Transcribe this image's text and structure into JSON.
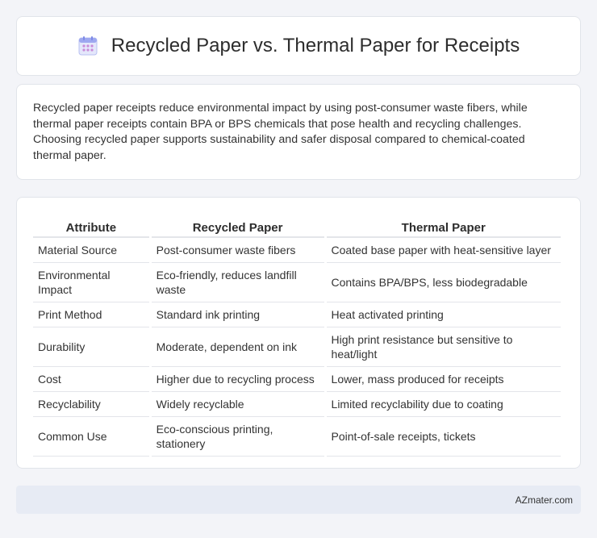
{
  "header": {
    "title": "Recycled Paper vs. Thermal Paper for Receipts",
    "icon": "calendar-icon"
  },
  "summary": {
    "text": "Recycled paper receipts reduce environmental impact by using post-consumer waste fibers, while thermal paper receipts contain BPA or BPS chemicals that pose health and recycling challenges. Choosing recycled paper supports sustainability and safer disposal compared to chemical-coated thermal paper."
  },
  "table": {
    "headers": [
      "Attribute",
      "Recycled Paper",
      "Thermal Paper"
    ],
    "rows": [
      [
        "Material Source",
        "Post-consumer waste fibers",
        "Coated base paper with heat-sensitive layer"
      ],
      [
        "Environmental Impact",
        "Eco-friendly, reduces landfill waste",
        "Contains BPA/BPS, less biodegradable"
      ],
      [
        "Print Method",
        "Standard ink printing",
        "Heat activated printing"
      ],
      [
        "Durability",
        "Moderate, dependent on ink",
        "High print resistance but sensitive to heat/light"
      ],
      [
        "Cost",
        "Higher due to recycling process",
        "Lower, mass produced for receipts"
      ],
      [
        "Recyclability",
        "Widely recyclable",
        "Limited recyclability due to coating"
      ],
      [
        "Common Use",
        "Eco-conscious printing, stationery",
        "Point-of-sale receipts, tickets"
      ]
    ]
  },
  "footer": {
    "text": "AZmater.com"
  },
  "colors": {
    "background": "#f3f4f8",
    "card": "#ffffff",
    "footer": "#e7ebf4",
    "icon_accent": "#9ea8f0"
  }
}
